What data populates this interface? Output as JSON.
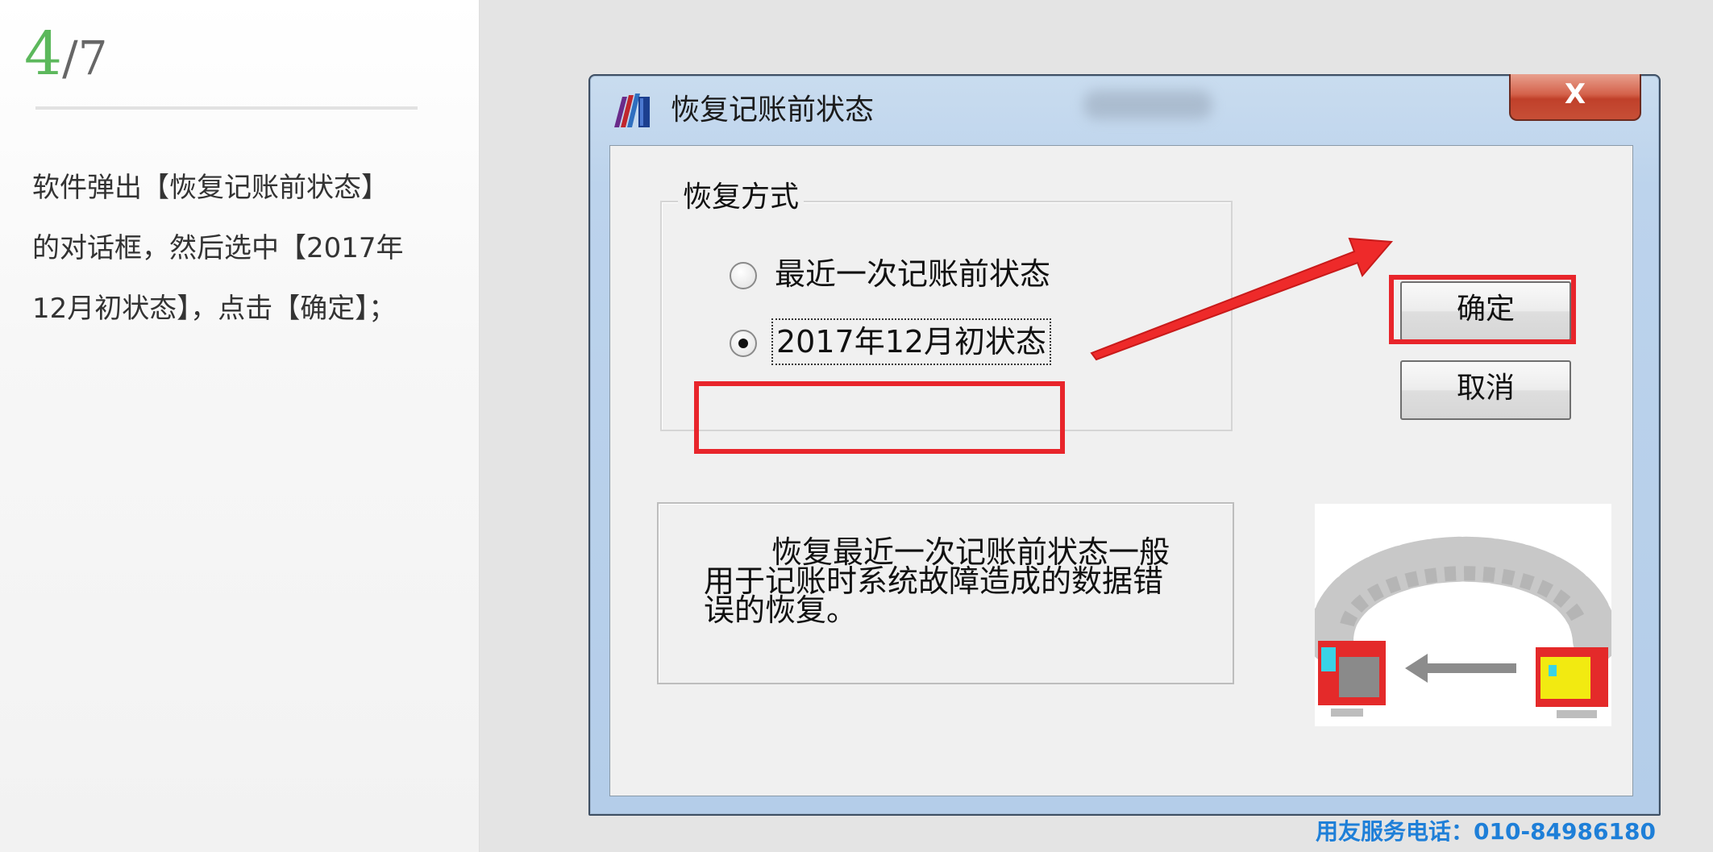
{
  "step": {
    "current": "4",
    "total": "/7"
  },
  "instruction": "软件弹出【恢复记账前状态】的对话框，然后选中【2017年12月初状态】，点击【确定】；",
  "dialog": {
    "title": "恢复记账前状态",
    "close_label": "X",
    "groupbox_label": "恢复方式",
    "options": [
      {
        "label": "最近一次记账前状态",
        "selected": false
      },
      {
        "label": "2017年12月初状态",
        "selected": true
      }
    ],
    "description": "恢复最近一次记账前状态一般用于记账时系统故障造成的数据错误的恢复。",
    "confirm_label": "确定",
    "cancel_label": "取消"
  },
  "annotation": {
    "highlight_color": "#e8252b"
  },
  "footer": {
    "hotline": "用友服务电话：010-84986180"
  },
  "colors": {
    "step_accent": "#5cb85c",
    "hotline": "#1e7fd8"
  }
}
